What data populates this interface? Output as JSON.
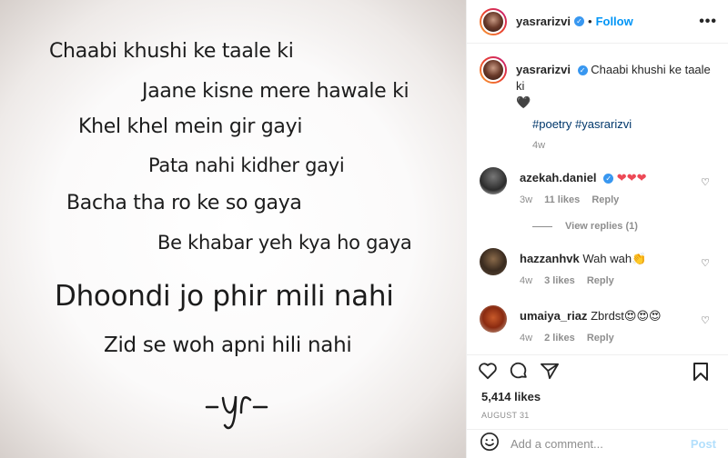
{
  "post": {
    "lines": [
      "Chaabi khushi ke taale ki",
      "Jaane kisne mere hawale ki",
      "Khel khel mein gir gayi",
      "Pata nahi kidher gayi",
      "Bacha tha ro ke so gaya",
      "Be khabar yeh kya ho gaya",
      "Dhoondi jo phir mili nahi",
      "Zid se woh apni hili nahi"
    ],
    "signature": "-yr-"
  },
  "header": {
    "username": "yasrarizvi",
    "separator": "•",
    "follow_label": "Follow",
    "more_icon": "more-horizontal-icon"
  },
  "caption": {
    "username": "yasrarizvi",
    "text": "Chaabi khushi ke taale ki",
    "heart": "🖤",
    "hashtags": [
      "#poetry",
      "#yasrarizvi"
    ],
    "time": "4w"
  },
  "comments": [
    {
      "username": "azekah.daniel",
      "text": "❤❤❤",
      "time": "3w",
      "likes": "11 likes",
      "reply": "Reply",
      "verified": true
    },
    {
      "username": "hazzanhvk",
      "text": "Wah wah👏",
      "time": "4w",
      "likes": "3 likes",
      "reply": "Reply",
      "verified": false
    },
    {
      "username": "umaiya_riaz",
      "text": "Zbrdst😍😍😍",
      "time": "4w",
      "likes": "2 likes",
      "reply": "Reply",
      "verified": false
    }
  ],
  "view_replies": "View replies (1)",
  "actions": {
    "likes": "5,414 likes",
    "date": "AUGUST 31"
  },
  "add_comment": {
    "placeholder": "Add a comment...",
    "post_label": "Post"
  },
  "colors": {
    "accent": "#0095f6",
    "link": "#00376b",
    "heart_red": "#ed4956",
    "muted": "#8e8e8e"
  }
}
